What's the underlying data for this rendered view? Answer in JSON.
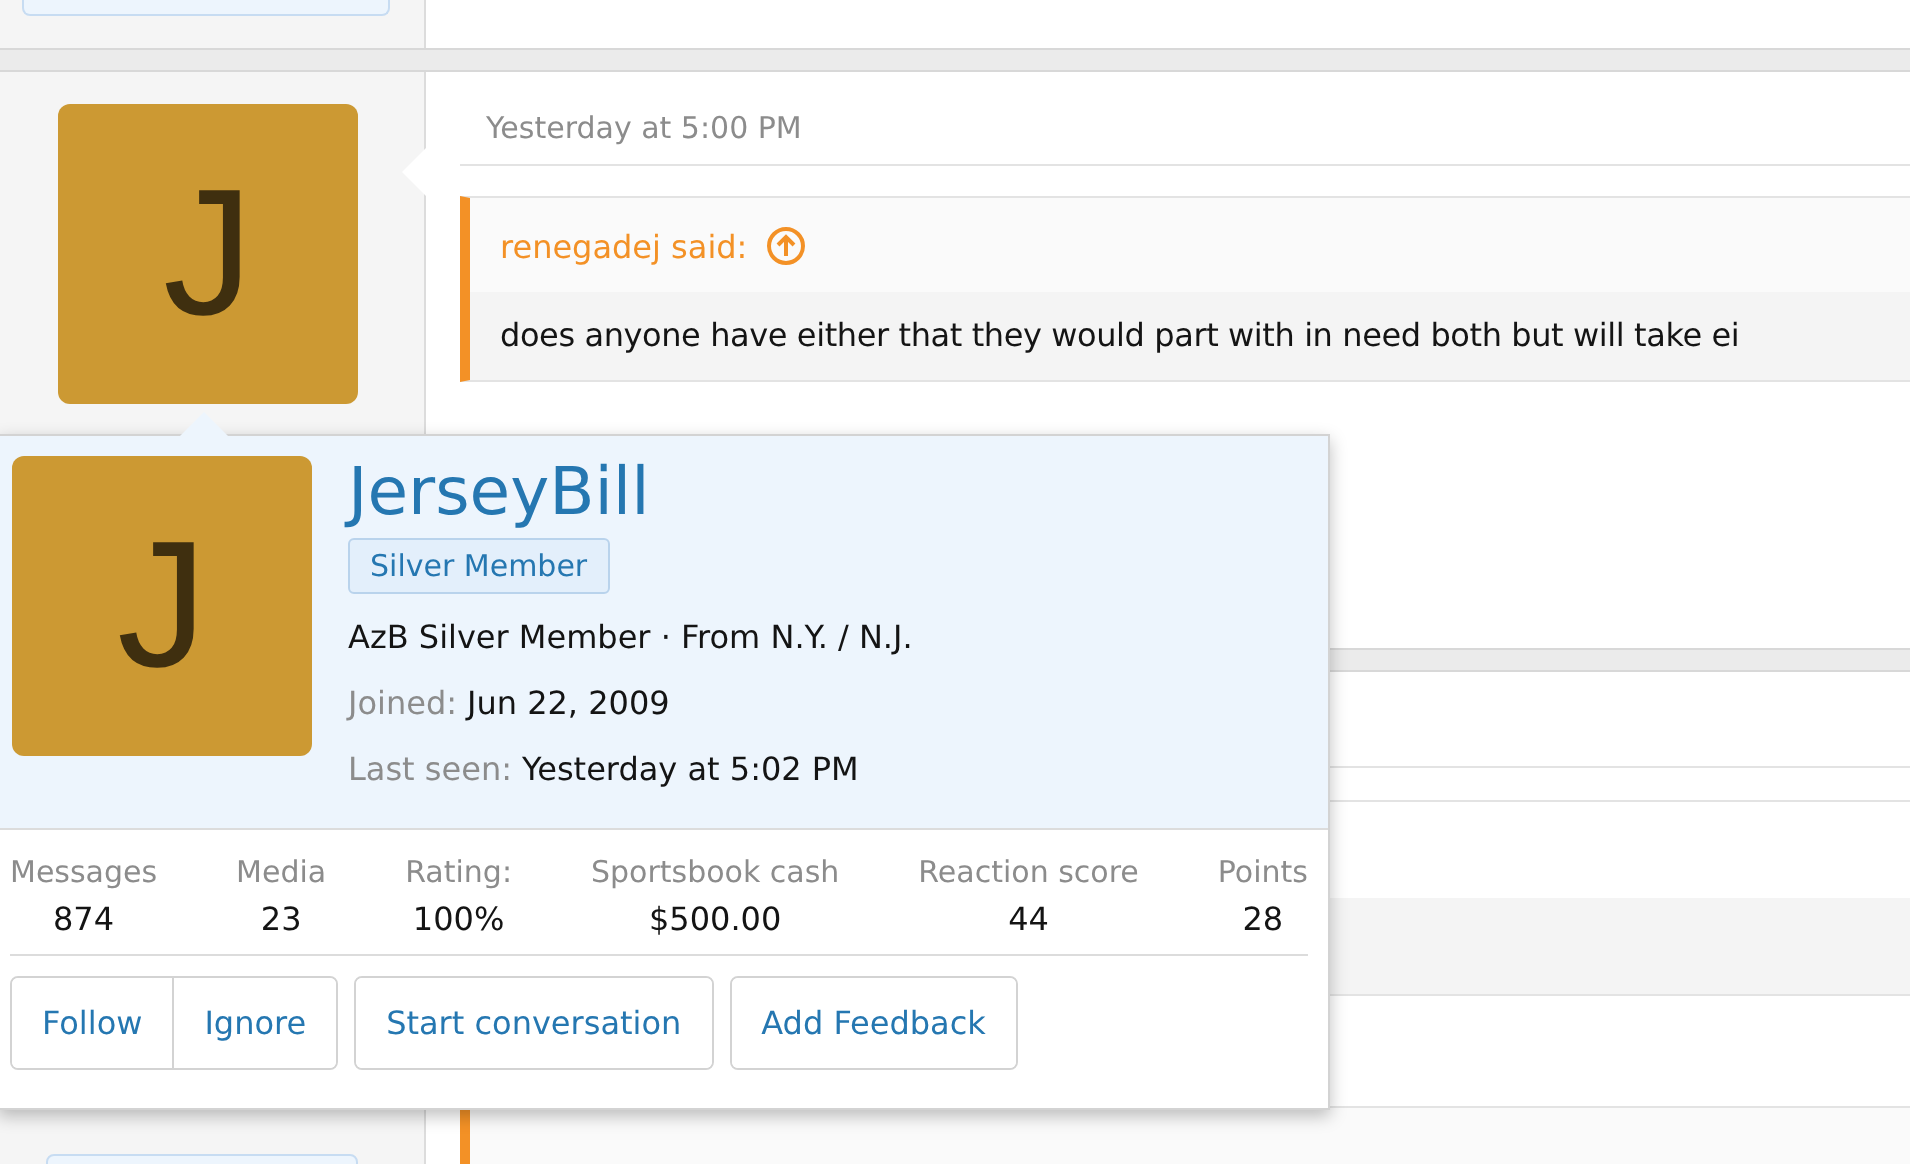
{
  "post": {
    "avatar_letter": "J",
    "time": "Yesterday at 5:00 PM",
    "quote": {
      "author": "renegadej said:",
      "text": "does anyone have either that they would part with in need both but will take ei"
    }
  },
  "member_card": {
    "avatar_letter": "J",
    "username": "JerseyBill",
    "banner": "Silver Member",
    "user_line": "AzB Silver Member · From N.Y. / N.J.",
    "details": [
      {
        "label": "Joined:",
        "value": "Jun 22, 2009"
      },
      {
        "label": "Last seen:",
        "value": "Yesterday at 5:02 PM"
      }
    ],
    "stats": [
      {
        "label": "Messages",
        "value": "874"
      },
      {
        "label": "Media",
        "value": "23"
      },
      {
        "label": "Rating:",
        "value": "100%"
      },
      {
        "label": "Sportsbook cash",
        "value": "$500.00"
      },
      {
        "label": "Reaction score",
        "value": "44"
      },
      {
        "label": "Points",
        "value": "28"
      }
    ],
    "button_groups": [
      [
        "Follow",
        "Ignore"
      ],
      [
        "Start conversation"
      ],
      [
        "Add Feedback"
      ]
    ]
  }
}
